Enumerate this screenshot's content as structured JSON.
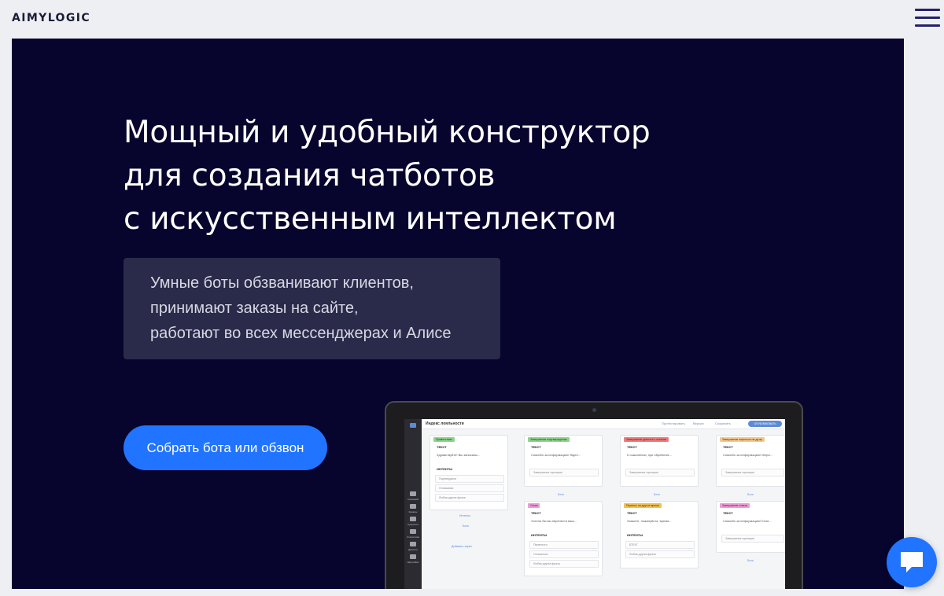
{
  "header": {
    "logo": "AIMYLOGIC",
    "menu_icon": "hamburger-menu-icon"
  },
  "hero": {
    "title_lines": [
      "Мощный и удобный конструктор",
      "для создания чатботов",
      "с искусственным интеллектом"
    ],
    "subtitle_lines": [
      "Умные боты обзванивают клиентов,",
      "принимают заказы на сайте,",
      "работают во всех мессенджерах и Алисе"
    ],
    "cta_label": "Собрать бота или обзвон"
  },
  "mockup": {
    "project_title": "Индекс лояльности",
    "publish_label": "ОПУБЛИКОВАТЬ",
    "top_links": [
      "Протестировать",
      "Версии",
      "Сохранить"
    ],
    "sidebar": [
      "Сценарий",
      "Каналы",
      "Сущности",
      "Статистика",
      "Диалоги",
      "Настройки"
    ],
    "col1": {
      "tag": "Приветствие",
      "text_label": "ТЕКСТ",
      "text": "Здравствуйте! Вы записаны...",
      "intents_label": "ИНТЕНТЫ",
      "intents": [
        "Подтвердили",
        "Отказываю",
        "Любая другая фраза"
      ],
      "add_intent": "Интенты",
      "add_block": "Блок",
      "add_screen": "Добавить экран"
    },
    "col2": {
      "tag": "Завершение подтверждения",
      "text": "Спасибо за информацию! Жден...",
      "end": "Завершение сценария",
      "tag2": "Отказ",
      "text2": "Хотели бы вы перенести ваш...",
      "intents": [
        "Перенести",
        "Отказаться",
        "Любая другая фраза"
      ]
    },
    "col3": {
      "tag": "Завершение диалога с отказом",
      "text": "К сожалению, при обработке...",
      "end": "Завершение сценария",
      "tag2": "Перенос на другое время",
      "text2": "Укажите, пожалуйста, время...",
      "intents": [
        "$TEXT",
        "Любая другая фраза"
      ]
    },
    "col4": {
      "tag": "Завершение переноса на др.вр",
      "text": "Спасибо за информацию! Инфо...",
      "end": "Завершение сценария",
      "tag2": "Завершение отказа",
      "text2": "Спасибо за информацию! Если...",
      "end2": "Завершение сценария"
    },
    "block_label": "Блок",
    "text_label": "ТЕКСТ",
    "intents_label": "ИНТЕНТЫ"
  },
  "chat_widget": {
    "icon": "chat-bubble-icon"
  },
  "colors": {
    "hero_bg": "#07042e",
    "accent": "#2174ff",
    "subtitle_box": "#2a2a4a",
    "page_bg": "#eeeff3"
  }
}
